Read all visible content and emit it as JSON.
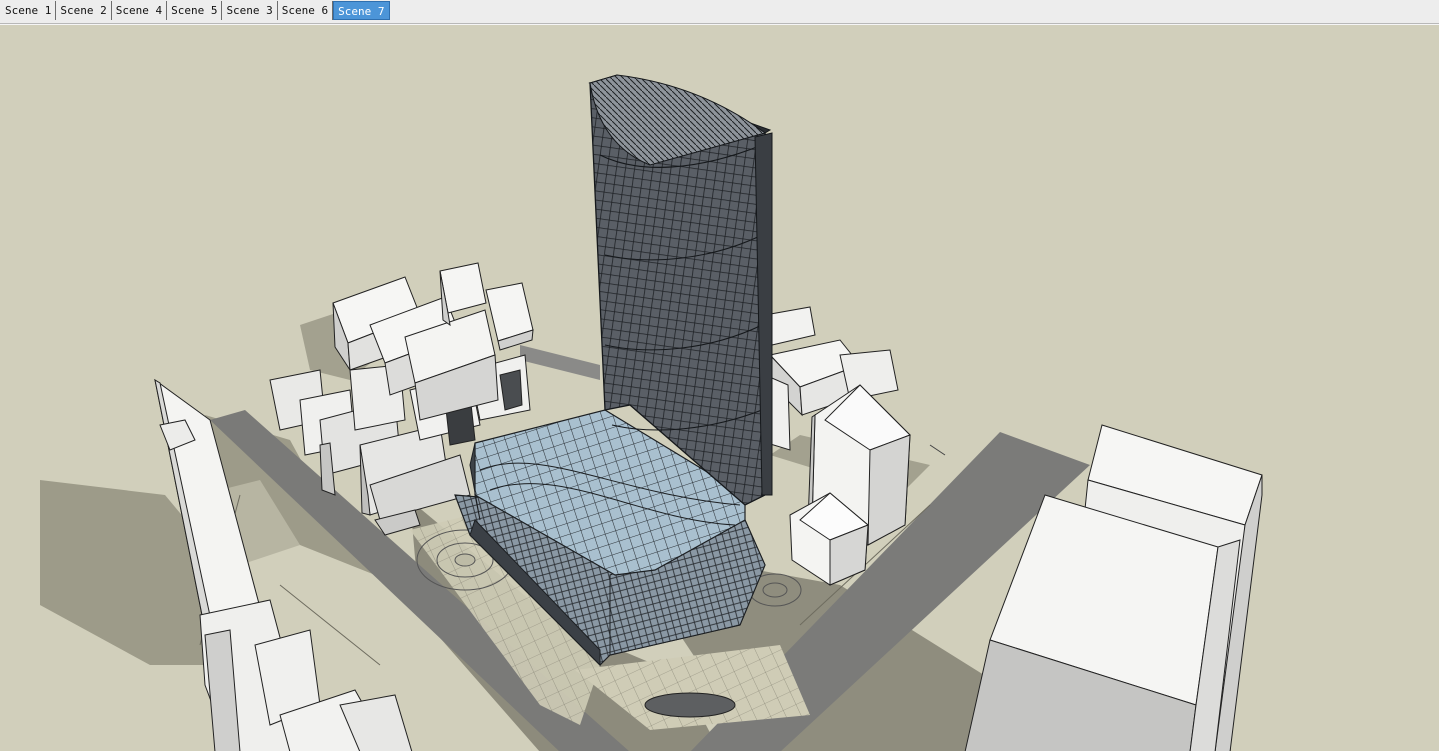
{
  "scenes": {
    "tabs": [
      {
        "label": "Scene 1",
        "active": false
      },
      {
        "label": "Scene 2",
        "active": false
      },
      {
        "label": "Scene 4",
        "active": false
      },
      {
        "label": "Scene 5",
        "active": false
      },
      {
        "label": "Scene 3",
        "active": false
      },
      {
        "label": "Scene 6",
        "active": false
      },
      {
        "label": "Scene 7",
        "active": true
      }
    ]
  },
  "colors": {
    "background": "#d1cfbb",
    "ground_shadow": "#9a9886",
    "road": "#7d7d7b",
    "massing_white": "#f2f2f2",
    "massing_grey": "#c9c9c9",
    "glass_dark": "#4b5056",
    "glass_light": "#9fb8c8",
    "active_tab": "#4c95d8"
  }
}
